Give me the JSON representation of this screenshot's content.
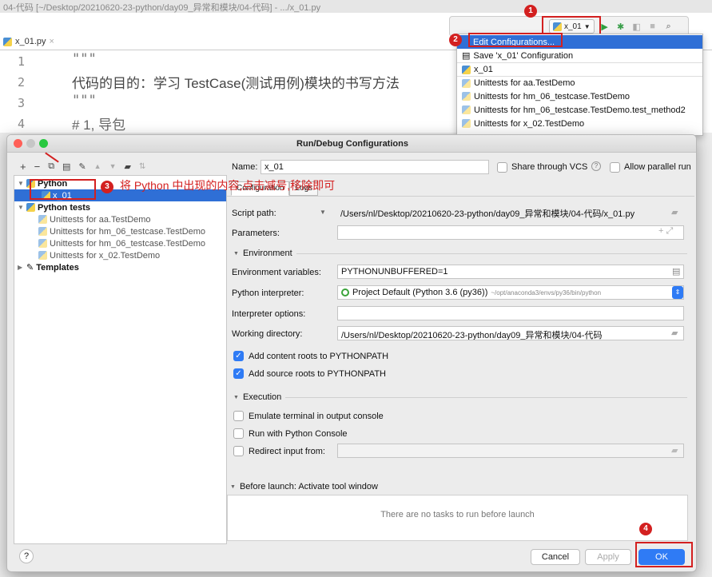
{
  "editor": {
    "window_title": "04-代码 [~/Desktop/20210620-23-python/day09_异常和模块/04-代码] - .../x_01.py",
    "file_tab": "x_01.py",
    "lines": [
      {
        "num": "1",
        "text": "\"\"\""
      },
      {
        "num": "2",
        "text": "代码的目的：学习 TestCase(测试用例)模块的书写方法"
      },
      {
        "num": "3",
        "text": "\"\"\""
      },
      {
        "num": "4",
        "text": "# 1, 导包"
      }
    ]
  },
  "toolbar": {
    "config_name": "x_01"
  },
  "dropdown": {
    "items": [
      {
        "label": "Edit Configurations...",
        "selected": true
      },
      {
        "label": "Save 'x_01' Configuration"
      },
      {
        "label": "x_01"
      },
      {
        "label": "Unittests for aa.TestDemo"
      },
      {
        "label": "Unittests for hm_06_testcase.TestDemo"
      },
      {
        "label": "Unittests for hm_06_testcase.TestDemo.test_method2"
      },
      {
        "label": "Unittests for x_02.TestDemo"
      }
    ]
  },
  "dialog": {
    "title": "Run/Debug Configurations",
    "tree": [
      {
        "label": "Python",
        "level": 0,
        "bold": true
      },
      {
        "label": "x_01",
        "level": 1,
        "selected": true
      },
      {
        "label": "Python tests",
        "level": 0,
        "bold": true
      },
      {
        "label": "Unittests for aa.TestDemo",
        "level": 1
      },
      {
        "label": "Unittests for hm_06_testcase.TestDemo",
        "level": 1
      },
      {
        "label": "Unittests for hm_06_testcase.TestDemo",
        "level": 1
      },
      {
        "label": "Unittests for x_02.TestDemo",
        "level": 1
      },
      {
        "label": "Templates",
        "level": 0,
        "bold": true
      }
    ],
    "name_label": "Name:",
    "name_value": "x_01",
    "share_label": "Share through VCS",
    "parallel_label": "Allow parallel run",
    "tabs": [
      "Configuration",
      "Logs"
    ],
    "script_path_label": "Script path:",
    "script_path": "/Users/nl/Desktop/20210620-23-python/day09_异常和模块/04-代码/x_01.py",
    "parameters_label": "Parameters:",
    "environment_section": "Environment",
    "env_vars_label": "Environment variables:",
    "env_vars": "PYTHONUNBUFFERED=1",
    "interpreter_label": "Python interpreter:",
    "interpreter": "Project Default (Python 3.6 (py36))",
    "interpreter_path": "~/opt/anaconda3/envs/py36/bin/python",
    "interp_options_label": "Interpreter options:",
    "workdir_label": "Working directory:",
    "workdir": "/Users/nl/Desktop/20210620-23-python/day09_异常和模块/04-代码",
    "add_content_roots": "Add content roots to PYTHONPATH",
    "add_source_roots": "Add source roots to PYTHONPATH",
    "execution_section": "Execution",
    "emulate_terminal": "Emulate terminal in output console",
    "run_python_console": "Run with Python Console",
    "redirect_input": "Redirect input from:",
    "before_launch": "Before launch: Activate tool window",
    "no_tasks": "There are no tasks to run before launch",
    "help": "?",
    "cancel": "Cancel",
    "apply": "Apply",
    "ok": "OK"
  },
  "annotations": {
    "step1": "1",
    "step2": "2",
    "step3": "3",
    "step3_text": "将 Python 中出现的内容,点击减号,移除即可",
    "step4": "4"
  },
  "colors": {
    "accent": "#2f6fd6",
    "annotation_red": "#d32020",
    "ok_blue": "#2f7bf5"
  }
}
